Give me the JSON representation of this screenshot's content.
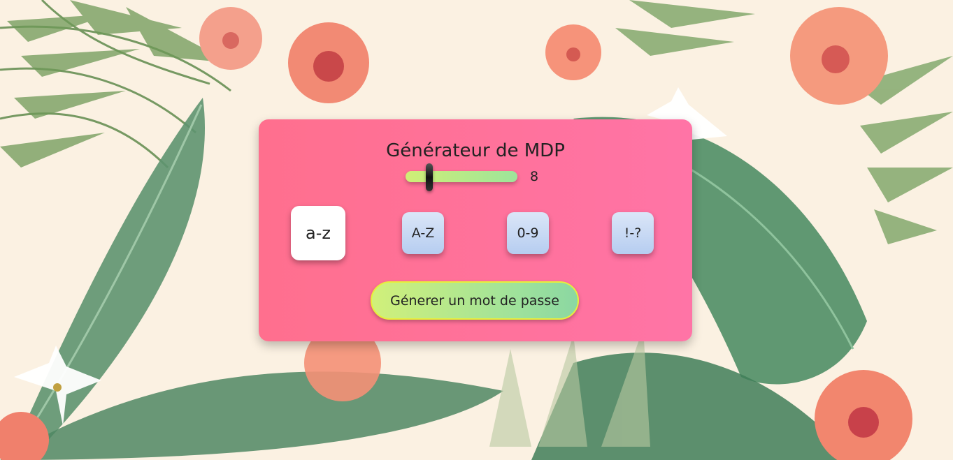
{
  "app": {
    "title": "Générateur de MDP"
  },
  "slider": {
    "value": "8",
    "fill_fraction": 0.2
  },
  "options": [
    {
      "label": "a-z",
      "active": true
    },
    {
      "label": "A-Z",
      "active": false
    },
    {
      "label": "0-9",
      "active": false
    },
    {
      "label": "!-?",
      "active": false
    }
  ],
  "generate_button": {
    "label": "Génerer un mot de passe"
  },
  "colors": {
    "card_left": "#ff6f8e",
    "card_right": "#ff74a6",
    "background": "#fbf1e2",
    "button_gradient_start": "#d1f07a",
    "button_gradient_end": "#8bd7a2"
  }
}
